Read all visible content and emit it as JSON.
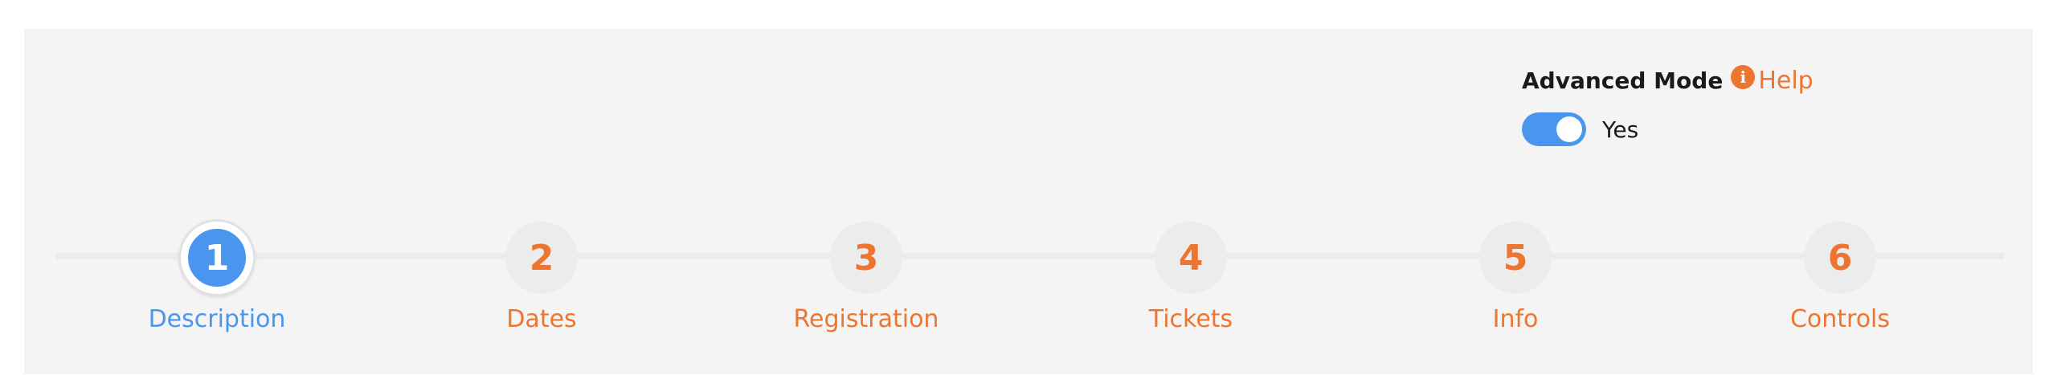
{
  "advanced_mode": {
    "title": "Advanced Mode",
    "help_label": "Help",
    "help_icon": "info-icon",
    "toggle_state": "on",
    "toggle_label": "Yes"
  },
  "stepper": {
    "active_step": 1,
    "steps": [
      {
        "number": "1",
        "label": "Description"
      },
      {
        "number": "2",
        "label": "Dates"
      },
      {
        "number": "3",
        "label": "Registration"
      },
      {
        "number": "4",
        "label": "Tickets"
      },
      {
        "number": "5",
        "label": "Info"
      },
      {
        "number": "6",
        "label": "Controls"
      }
    ]
  },
  "colors": {
    "accent_blue": "#4a96ef",
    "accent_orange": "#ed7530",
    "panel_bg": "#f4f4f4"
  }
}
